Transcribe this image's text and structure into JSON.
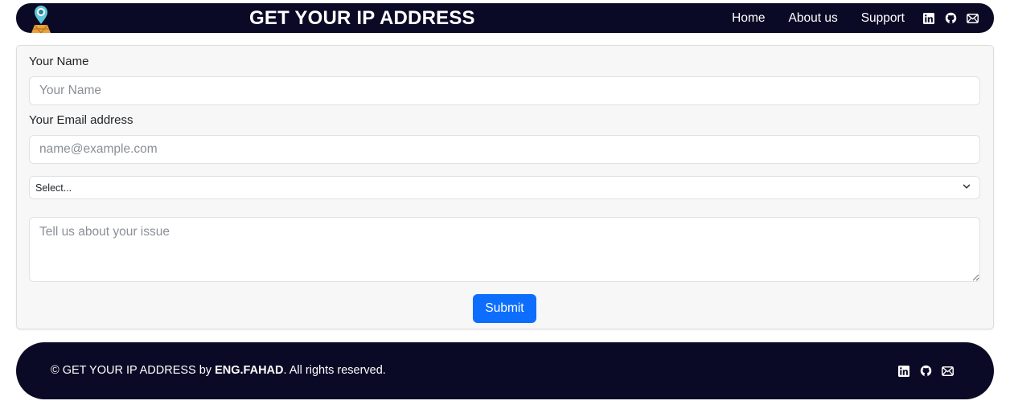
{
  "header": {
    "brand": "GET YOUR IP ADDRESS",
    "logo_icon": "location-pin-globe-icon",
    "nav": [
      "Home",
      "About us",
      "Support"
    ],
    "social_icons": [
      "linkedin-icon",
      "github-icon",
      "mail-icon"
    ]
  },
  "form": {
    "name_label": "Your Name",
    "name_placeholder": "Your Name",
    "name_value": "",
    "email_label": "Your Email address",
    "email_placeholder": "name@example.com",
    "email_value": "",
    "select_value": "Select...",
    "issue_placeholder": "Tell us about your issue",
    "issue_value": "",
    "submit_label": "Submit"
  },
  "footer": {
    "prefix": "© GET YOUR IP ADDRESS by ",
    "author": "ENG.FAHAD",
    "suffix": ". All rights reserved.",
    "social_icons": [
      "linkedin-icon",
      "github-icon",
      "mail-icon"
    ]
  },
  "colors": {
    "nav_bg": "#0b0a26",
    "accent": "#0d6efd",
    "card_bg": "#f7f7f7"
  }
}
